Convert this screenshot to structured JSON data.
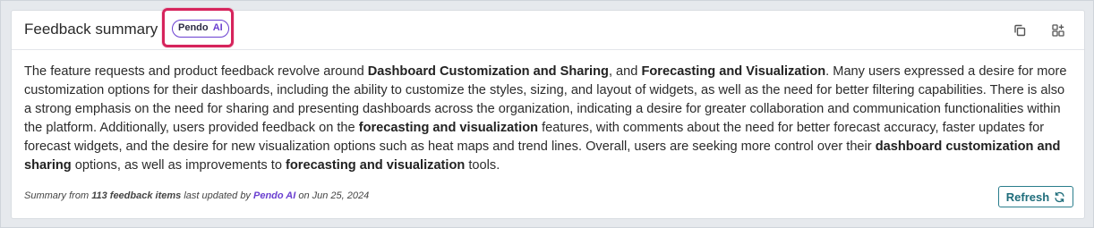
{
  "card": {
    "title": "Feedback summary",
    "badge": {
      "brand": "Pendo",
      "ai": "AI"
    },
    "actions": {
      "copy_icon": "copy-icon",
      "widget_icon": "add-widget-icon"
    }
  },
  "summary": {
    "s1": "The feature requests and product feedback revolve around ",
    "b1": "Dashboard Customization and Sharing",
    "s2": ", and ",
    "b2": "Forecasting and Visualization",
    "s3": ". Many users expressed a desire for more customization options for their dashboards, including the ability to customize the styles, sizing, and layout of widgets, as well as the need for better filtering capabilities. There is also a strong emphasis on the need for sharing and presenting dashboards across the organization, indicating a desire for greater collaboration and communication functionalities within the platform. Additionally, users provided feedback on the ",
    "b3": "forecasting and visualization",
    "s4": " features, with comments about the need for better forecast accuracy, faster updates for forecast widgets, and the desire for new visualization options such as heat maps and trend lines. Overall, users are seeking more control over their ",
    "b4": "dashboard customization and sharing",
    "s5": " options, as well as improvements to ",
    "b5": "forecasting and visualization",
    "s6": " tools."
  },
  "meta": {
    "prefix": "Summary from ",
    "count": "113 feedback items",
    "middle": " last updated by ",
    "author": "Pendo AI",
    "suffix": " on Jun 25, 2024"
  },
  "refresh": {
    "label": "Refresh",
    "icon": "refresh-icon"
  },
  "colors": {
    "accent_ai": "#6a3fd0",
    "highlight": "#d6245c",
    "teal": "#1f6d7b"
  }
}
